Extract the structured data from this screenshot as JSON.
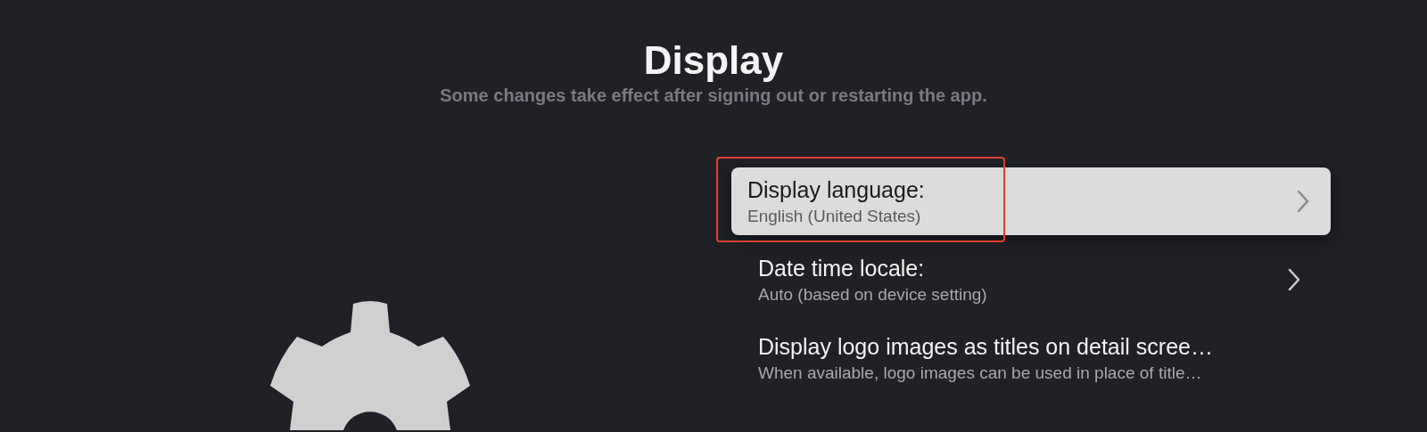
{
  "header": {
    "title": "Display",
    "subtitle": "Some changes take effect after signing out or restarting the app."
  },
  "settings": [
    {
      "label": "Display language:",
      "value": "English (United States)",
      "selected": true,
      "chevron": true,
      "outlined": true
    },
    {
      "label": "Date time locale:",
      "value": "Auto (based on device setting)",
      "selected": false,
      "chevron": true,
      "outlined": false
    },
    {
      "label": "Display logo images as titles on detail scree…",
      "value": "When available, logo images can be used in place of title…",
      "selected": false,
      "chevron": false,
      "outlined": false
    }
  ]
}
